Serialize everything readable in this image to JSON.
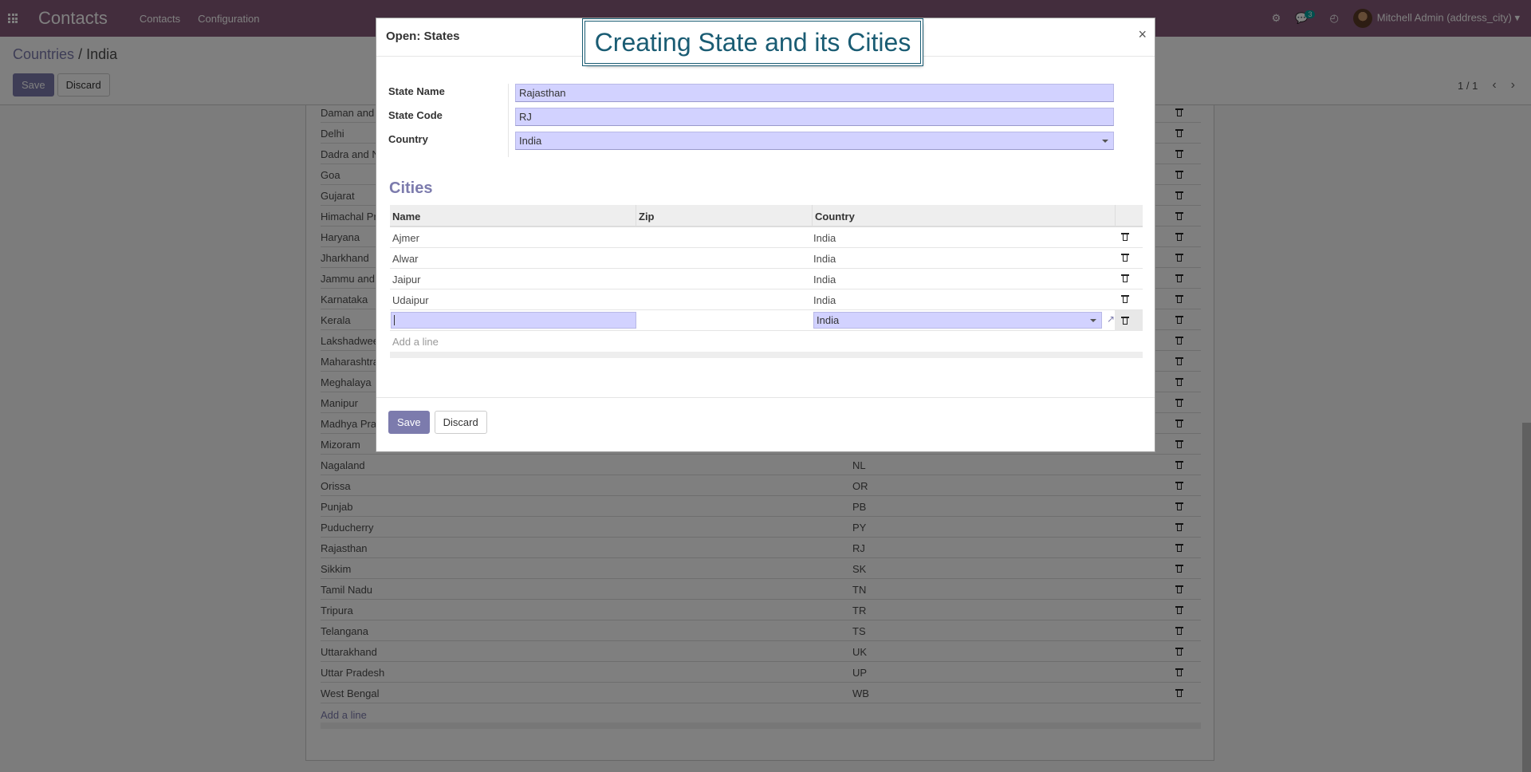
{
  "navbar": {
    "brand": "Contacts",
    "menu": [
      "Contacts",
      "Configuration"
    ],
    "chat_count": "3",
    "user": "Mitchell Admin (address_city)"
  },
  "control_panel": {
    "breadcrumb_parent": "Countries",
    "breadcrumb_sep": "/",
    "breadcrumb_current": "India",
    "save_label": "Save",
    "discard_label": "Discard",
    "pager": "1 / 1"
  },
  "background_list": {
    "rows": [
      {
        "name": "Daman and Diu",
        "code": ""
      },
      {
        "name": "Delhi",
        "code": ""
      },
      {
        "name": "Dadra and Nagar Haveli",
        "code": ""
      },
      {
        "name": "Goa",
        "code": ""
      },
      {
        "name": "Gujarat",
        "code": ""
      },
      {
        "name": "Himachal Pradesh",
        "code": ""
      },
      {
        "name": "Haryana",
        "code": ""
      },
      {
        "name": "Jharkhand",
        "code": ""
      },
      {
        "name": "Jammu and Kashmir",
        "code": ""
      },
      {
        "name": "Karnataka",
        "code": ""
      },
      {
        "name": "Kerala",
        "code": ""
      },
      {
        "name": "Lakshadweep",
        "code": ""
      },
      {
        "name": "Maharashtra",
        "code": ""
      },
      {
        "name": "Meghalaya",
        "code": ""
      },
      {
        "name": "Manipur",
        "code": ""
      },
      {
        "name": "Madhya Pradesh",
        "code": ""
      },
      {
        "name": "Mizoram",
        "code": ""
      },
      {
        "name": "Nagaland",
        "code": "NL"
      },
      {
        "name": "Orissa",
        "code": "OR"
      },
      {
        "name": "Punjab",
        "code": "PB"
      },
      {
        "name": "Puducherry",
        "code": "PY"
      },
      {
        "name": "Rajasthan",
        "code": "RJ"
      },
      {
        "name": "Sikkim",
        "code": "SK"
      },
      {
        "name": "Tamil Nadu",
        "code": "TN"
      },
      {
        "name": "Tripura",
        "code": "TR"
      },
      {
        "name": "Telangana",
        "code": "TS"
      },
      {
        "name": "Uttarakhand",
        "code": "UK"
      },
      {
        "name": "Uttar Pradesh",
        "code": "UP"
      },
      {
        "name": "West Bengal",
        "code": "WB"
      }
    ],
    "add_line": "Add a line"
  },
  "annotation": "Creating State and its Cities",
  "modal": {
    "title": "Open: States",
    "close": "×",
    "fields": {
      "state_name_label": "State Name",
      "state_name_value": "Rajasthan",
      "state_code_label": "State Code",
      "state_code_value": "RJ",
      "country_label": "Country",
      "country_value": "India"
    },
    "cities_title": "Cities",
    "cities_table": {
      "headers": [
        "Name",
        "Zip",
        "Country"
      ],
      "rows": [
        {
          "name": "Ajmer",
          "zip": "",
          "country": "India"
        },
        {
          "name": "Alwar",
          "zip": "",
          "country": "India"
        },
        {
          "name": "Jaipur",
          "zip": "",
          "country": "India"
        },
        {
          "name": "Udaipur",
          "zip": "",
          "country": "India"
        }
      ],
      "edit_row_country": "India",
      "add_line": "Add a line"
    },
    "save_label": "Save",
    "discard_label": "Discard"
  }
}
